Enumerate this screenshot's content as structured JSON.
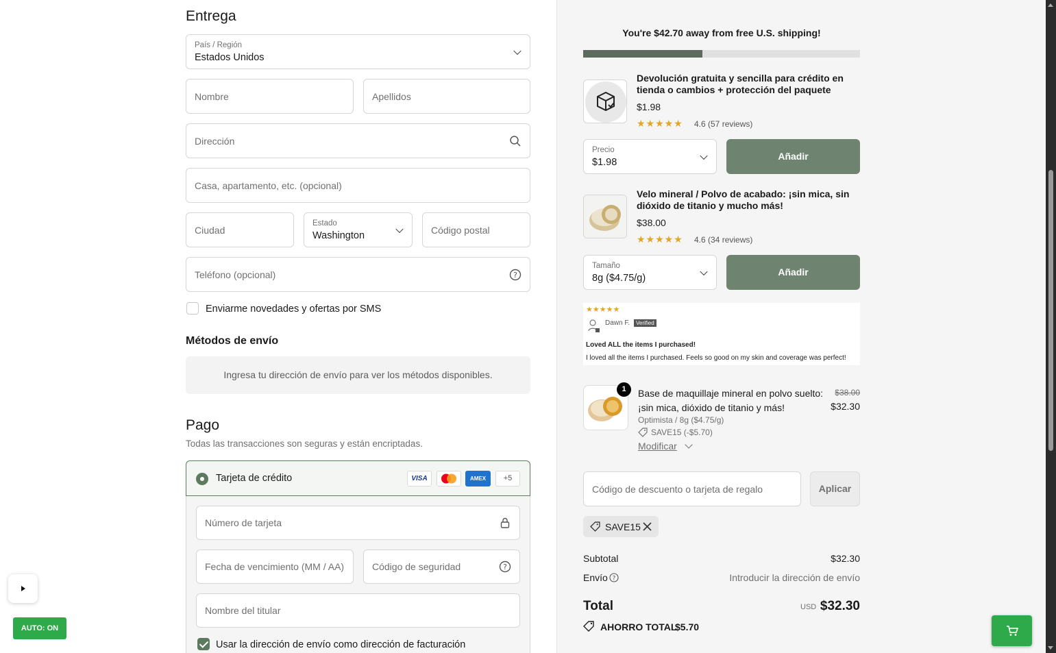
{
  "delivery": {
    "heading": "Entrega",
    "country": {
      "label": "País / Región",
      "value": "Estados Unidos"
    },
    "first_name_placeholder": "Nombre",
    "last_name_placeholder": "Apellidos",
    "address_placeholder": "Dirección",
    "apartment_placeholder": "Casa, apartamento, etc. (opcional)",
    "city_placeholder": "Ciudad",
    "state": {
      "label": "Estado",
      "value": "Washington"
    },
    "postal_placeholder": "Código postal",
    "phone_placeholder": "Teléfono (opcional)",
    "sms_label": "Enviarme novedades y ofertas por SMS",
    "sms_checked": false
  },
  "shipping_methods": {
    "heading": "Métodos de envío",
    "message": "Ingresa tu dirección de envío para ver los métodos disponibles."
  },
  "payment": {
    "heading": "Pago",
    "subtitle": "Todas las transacciones son seguras y están encriptadas.",
    "method_label": "Tarjeta de crédito",
    "cards": [
      "VISA",
      "AMEX"
    ],
    "more_cards": "+5",
    "card_number_placeholder": "Número de tarjeta",
    "expiry_placeholder": "Fecha de vencimiento (MM / AA)",
    "cvc_placeholder": "Código de seguridad",
    "holder_placeholder": "Nombre del titular",
    "billing_same_label": "Usar la dirección de envío como dirección de facturación",
    "billing_same_checked": true
  },
  "summary": {
    "free_shipping_msg": "You're $42.70 away from free U.S. shipping!",
    "free_shipping_progress": 0.43,
    "upsells": [
      {
        "title": "Devolución gratuita y sencilla para crédito en tienda o cambios + protección del paquete",
        "price": "$1.98",
        "stars": "★★★★★",
        "rating": "4.6 (57 reviews)",
        "select_label": "Precio",
        "select_value": "$1.98",
        "button": "Añadir"
      },
      {
        "title": "Velo mineral / Polvo de acabado: ¡sin mica, sin dióxido de titanio y mucho más!",
        "price": "$38.00",
        "stars": "★★★★★",
        "rating": "4.6 (34 reviews)",
        "select_label": "Tamaño",
        "select_value": "8g ($4.75/g)",
        "button": "Añadir"
      }
    ],
    "review": {
      "stars": "★★★★★",
      "name": "Dawn F.",
      "verified": "Verified",
      "title": "Loved ALL the items I purchased!",
      "body": "I loved all the items I purchased. Feels so good on my skin and coverage was perfect!"
    },
    "cart_item": {
      "quantity": "1",
      "title": "Base de maquillaje mineral en polvo suelto: ¡sin mica, dióxido de titanio y más!",
      "variant": "Optimista / 8g ($4.75/g)",
      "discount": "SAVE15 (-$5.70)",
      "original_price": "$38.00",
      "price": "$32.30",
      "modify_label": "Modificar"
    },
    "discount_placeholder": "Código de descuento o tarjeta de regalo",
    "apply_label": "Aplicar",
    "applied_code": "SAVE15",
    "subtotal_label": "Subtotal",
    "subtotal_value": "$32.30",
    "shipping_label": "Envío",
    "shipping_value": "Introducir la dirección de envío",
    "total_label": "Total",
    "currency": "USD",
    "total_value": "$32.30",
    "savings_label": "AHORRO TOTAL",
    "savings_value": "$5.70"
  },
  "overlay": {
    "auto_label": "AUTO: ON"
  },
  "colors": {
    "accent_green": "#5d7a5f",
    "add_button": "#6e8470",
    "fab_green": "#2eaa4a",
    "star": "#e0a722"
  }
}
